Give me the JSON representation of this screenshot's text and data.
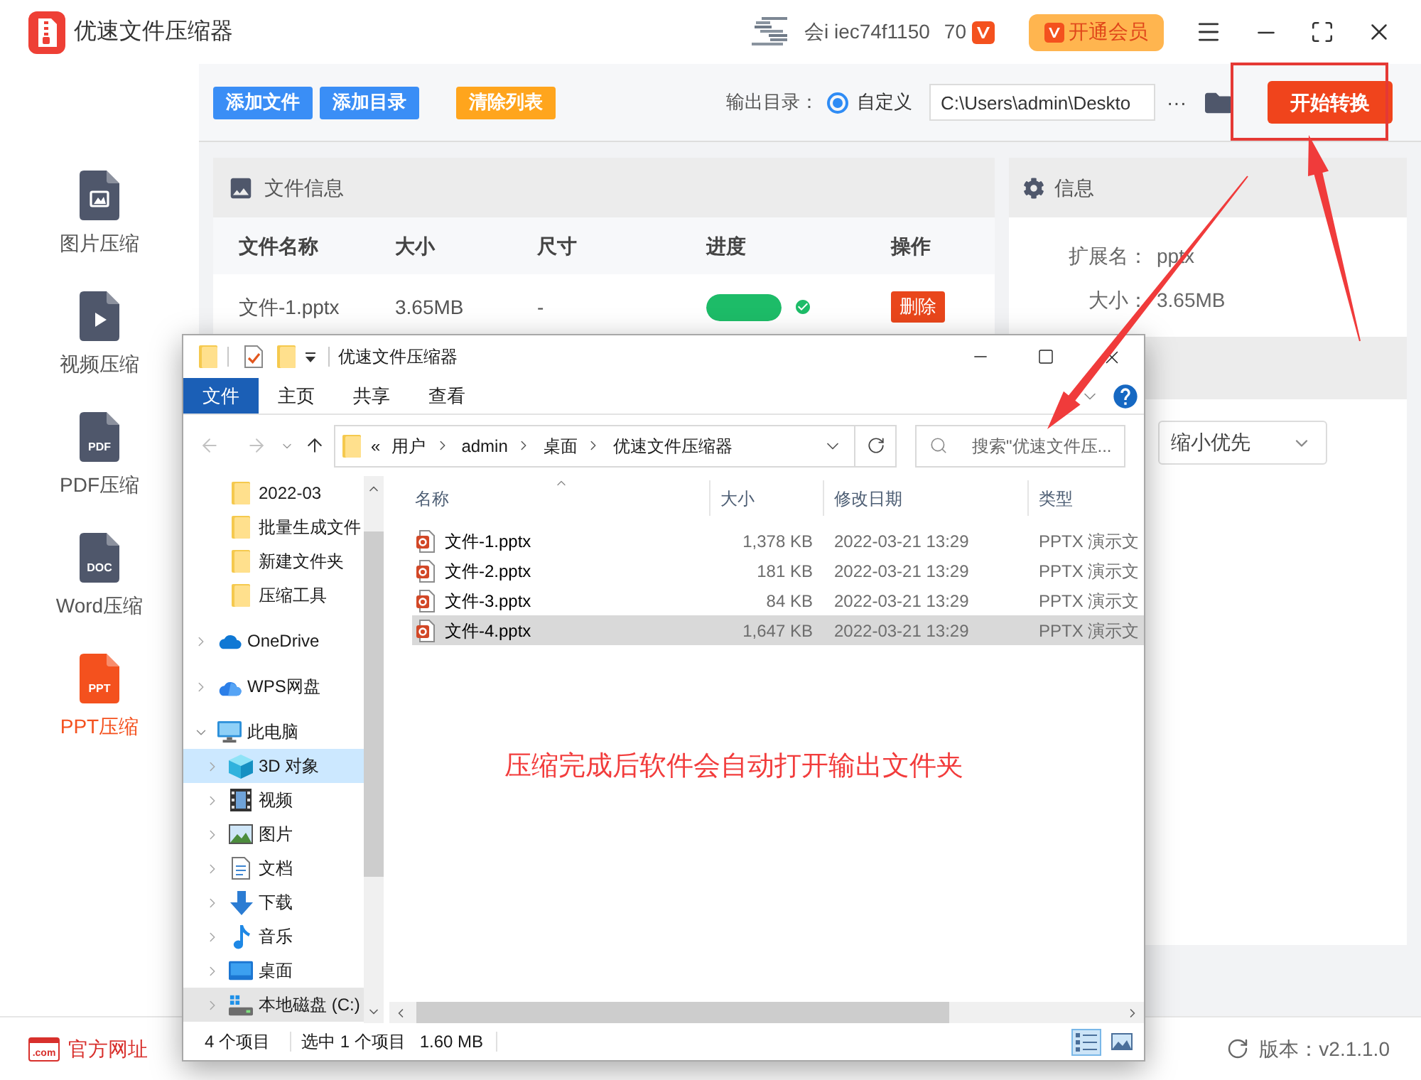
{
  "app": {
    "title": "优速文件压缩器",
    "account": "会i iec74f1150",
    "points": "70",
    "vip_button": "开通会员"
  },
  "toolbar": {
    "buttons": [
      {
        "label": "添加文件",
        "kind": "primary"
      },
      {
        "label": "添加目录",
        "kind": "primary"
      },
      {
        "label": "清除列表",
        "kind": "warning"
      }
    ],
    "output_label": "输出目录：",
    "output_options": [
      {
        "label": "自定义",
        "selected": true
      }
    ],
    "output_path": "C:\\Users\\admin\\Deskto",
    "more_button": "···",
    "start_button": "开始转换"
  },
  "sidebar": {
    "items": [
      {
        "label": "图片压缩",
        "kind": "image",
        "selected": false
      },
      {
        "label": "视频压缩",
        "kind": "video",
        "selected": false
      },
      {
        "label": "PDF压缩",
        "kind": "doc",
        "badge": "PDF",
        "selected": false
      },
      {
        "label": "Word压缩",
        "kind": "doc",
        "badge": "DOC",
        "selected": false
      },
      {
        "label": "PPT压缩",
        "kind": "doc",
        "badge": "PPT",
        "selected": true
      }
    ]
  },
  "file_panel": {
    "title": "文件信息",
    "columns": [
      "文件名称",
      "大小",
      "尺寸",
      "进度",
      "操作"
    ],
    "rows": [
      {
        "name": "文件-1.pptx",
        "size": "3.65MB",
        "dimensions": "-",
        "progress": {
          "level": 1,
          "done": true
        },
        "action": "删除"
      }
    ]
  },
  "info_panel": {
    "title": "信息",
    "fields": [
      {
        "label": "扩展名：",
        "value": "pptx"
      },
      {
        "label": "大小：",
        "value": "3.65MB"
      }
    ],
    "mode_select": "缩小优先"
  },
  "footer": {
    "website_icon": ".com",
    "website_link": "官方网址",
    "version": "版本：v2.1.1.0"
  },
  "explorer": {
    "title": "优速文件压缩器",
    "ribbon_tabs": [
      {
        "label": "文件",
        "selected": true
      },
      {
        "label": "主页",
        "selected": false
      },
      {
        "label": "共享",
        "selected": false
      },
      {
        "label": "查看",
        "selected": false
      }
    ],
    "path_prefix": "«",
    "path": [
      "用户",
      "admin",
      "桌面",
      "优速文件压缩器"
    ],
    "search_placeholder": "搜索\"优速文件压...",
    "nav_tree": [
      {
        "children": [
          {
            "label": "2022-03",
            "kind": "folder",
            "selected": false,
            "hovered": false
          },
          {
            "label": "批量生成文件",
            "kind": "folder",
            "selected": false,
            "hovered": false
          },
          {
            "label": "新建文件夹",
            "kind": "folder",
            "selected": false,
            "hovered": false
          },
          {
            "label": "压缩工具",
            "kind": "folder",
            "selected": false,
            "hovered": false
          }
        ]
      },
      {
        "label": "OneDrive",
        "kind": "onedrive",
        "expanded": false,
        "selected": false,
        "hovered": false
      },
      {
        "label": "WPS网盘",
        "kind": "wps",
        "expanded": false,
        "selected": false,
        "hovered": false
      },
      {
        "label": "此电脑",
        "kind": "pc",
        "expanded": true,
        "selected": false,
        "hovered": false,
        "children": [
          {
            "label": "3D 对象",
            "kind": "cube",
            "expanded": false,
            "selected": true,
            "hovered": false
          },
          {
            "label": "视频",
            "kind": "video",
            "expanded": false,
            "selected": false,
            "hovered": false
          },
          {
            "label": "图片",
            "kind": "picture",
            "expanded": false,
            "selected": false,
            "hovered": false
          },
          {
            "label": "文档",
            "kind": "document",
            "expanded": false,
            "selected": false,
            "hovered": false
          },
          {
            "label": "下载",
            "kind": "download",
            "expanded": false,
            "selected": false,
            "hovered": false
          },
          {
            "label": "音乐",
            "kind": "music",
            "expanded": false,
            "selected": false,
            "hovered": false
          },
          {
            "label": "桌面",
            "kind": "desktop",
            "expanded": false,
            "selected": false,
            "hovered": false
          },
          {
            "label": "本地磁盘 (C:)",
            "kind": "disk",
            "expanded": false,
            "selected": false,
            "hovered": true
          }
        ]
      }
    ],
    "columns": [
      {
        "label": "名称",
        "sorted": true
      },
      {
        "label": "大小",
        "sorted": false
      },
      {
        "label": "修改日期",
        "sorted": false
      },
      {
        "label": "类型",
        "sorted": false
      }
    ],
    "files": [
      {
        "name": "文件-1.pptx",
        "size": "1,378 KB",
        "modified": "2022-03-21 13:29",
        "type": "PPTX 演示文",
        "selected": false
      },
      {
        "name": "文件-2.pptx",
        "size": "181 KB",
        "modified": "2022-03-21 13:29",
        "type": "PPTX 演示文",
        "selected": false
      },
      {
        "name": "文件-3.pptx",
        "size": "84 KB",
        "modified": "2022-03-21 13:29",
        "type": "PPTX 演示文",
        "selected": false
      },
      {
        "name": "文件-4.pptx",
        "size": "1,647 KB",
        "modified": "2022-03-21 13:29",
        "type": "PPTX 演示文",
        "selected": true
      }
    ],
    "status": {
      "count": "4 个项目",
      "selection": "选中 1 个项目",
      "selection_size": "1.60 MB"
    },
    "view_modes": [
      {
        "kind": "details",
        "selected": true
      },
      {
        "kind": "thumbnails",
        "selected": false
      }
    ]
  },
  "annotation": "压缩完成后软件会自动打开输出文件夹"
}
